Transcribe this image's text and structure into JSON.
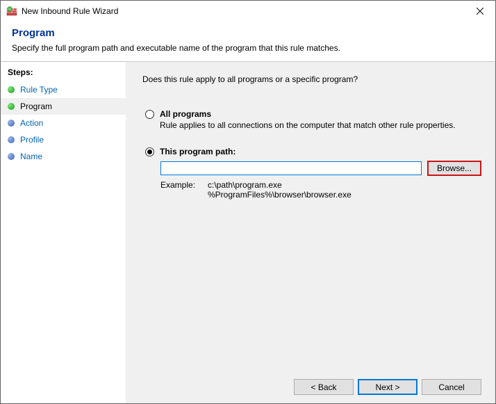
{
  "window": {
    "title": "New Inbound Rule Wizard"
  },
  "header": {
    "title": "Program",
    "subtitle": "Specify the full program path and executable name of the program that this rule matches."
  },
  "sidebar": {
    "title": "Steps:",
    "steps": [
      {
        "label": "Rule Type",
        "state": "completed"
      },
      {
        "label": "Program",
        "state": "current"
      },
      {
        "label": "Action",
        "state": "pending"
      },
      {
        "label": "Profile",
        "state": "pending"
      },
      {
        "label": "Name",
        "state": "pending"
      }
    ]
  },
  "main": {
    "question": "Does this rule apply to all programs or a specific program?",
    "options": {
      "all": {
        "label": "All programs",
        "desc": "Rule applies to all connections on the computer that match other rule properties."
      },
      "path": {
        "label": "This program path:",
        "value": "",
        "browse": "Browse...",
        "example_label": "Example:",
        "example_text": "c:\\path\\program.exe\n%ProgramFiles%\\browser\\browser.exe"
      }
    }
  },
  "footer": {
    "back": "< Back",
    "next": "Next >",
    "cancel": "Cancel"
  }
}
